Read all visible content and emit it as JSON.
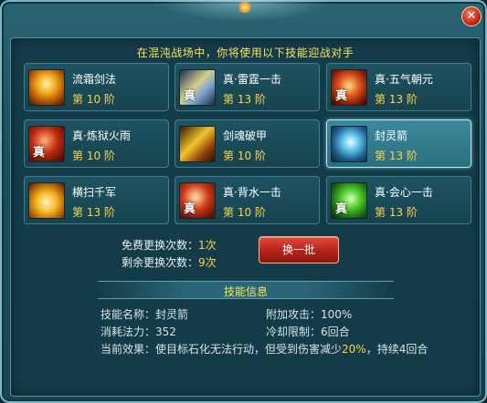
{
  "prompt": "在混沌战场中，你将使用以下技能迎战对手",
  "close_label": "✕",
  "skills": [
    {
      "name": "流霜剑法",
      "level": "第 10 阶",
      "icon": "sword-flame-icon"
    },
    {
      "name": "真·雷霆一击",
      "level": "第 13 阶",
      "icon": "thunder-strike-icon"
    },
    {
      "name": "真·五气朝元",
      "level": "第 13 阶",
      "icon": "five-qi-icon"
    },
    {
      "name": "真·炼狱火雨",
      "level": "第 10 阶",
      "icon": "fire-rain-icon"
    },
    {
      "name": "剑魂破甲",
      "level": "第 10 阶",
      "icon": "armor-break-icon"
    },
    {
      "name": "封灵箭",
      "level": "第 13 阶",
      "icon": "seal-arrow-icon"
    },
    {
      "name": "横扫千军",
      "level": "第 13 阶",
      "icon": "sweep-army-icon"
    },
    {
      "name": "真·背水一击",
      "level": "第 10 阶",
      "icon": "back-water-icon"
    },
    {
      "name": "真·会心一击",
      "level": "第 13 阶",
      "icon": "critical-strike-icon"
    }
  ],
  "counts": {
    "free_label": "免费更换次数：",
    "free_value": "1次",
    "remaining_label": "剩余更换次数：",
    "remaining_value": "9次"
  },
  "refresh_label": "换一批",
  "info": {
    "title": "技能信息",
    "skill_name": "技能名称：封灵箭",
    "bonus_attack": "附加攻击：100%",
    "mana_cost": "消耗法力：352",
    "cooldown": "冷却限制：6回合",
    "effect_prefix": "当前效果：使目标石化无法行动，但受到伤害减少",
    "effect_highlight": "20%",
    "effect_suffix": "，持续4回合"
  },
  "colors": {
    "accent_yellow": "#ffd34a",
    "title_yellow": "#ffe35a",
    "button_red": "#b3231a",
    "panel_teal": "#133c48"
  }
}
